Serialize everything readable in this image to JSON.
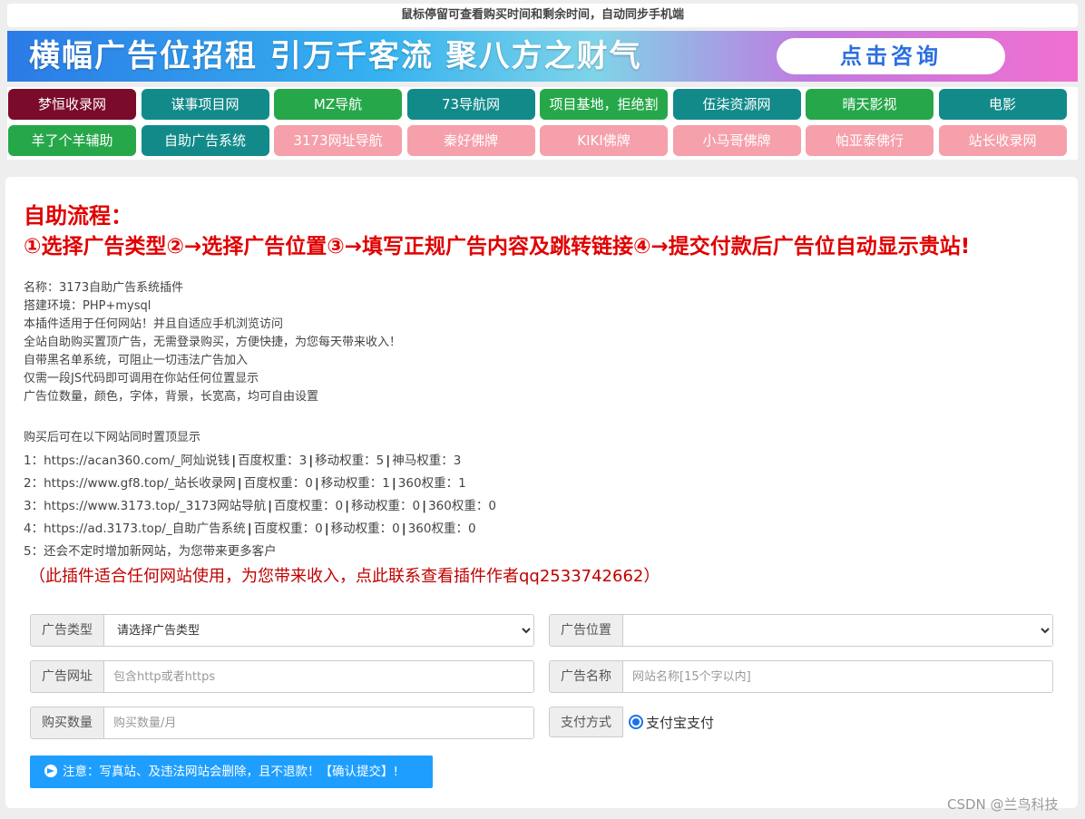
{
  "tip": "鼠标停留可查看购买时间和剩余时间，自动同步手机端",
  "banner": {
    "text": "横幅广告位招租  引万千客流  聚八方之财气",
    "button": "点击咨询"
  },
  "links": [
    {
      "label": "梦恒收录网",
      "color": "#7b0b2b"
    },
    {
      "label": "谋事项目网",
      "color": "#128a8a"
    },
    {
      "label": "MZ导航",
      "color": "#26a84a"
    },
    {
      "label": "73导航网",
      "color": "#128a8a"
    },
    {
      "label": "项目基地，拒绝割",
      "color": "#26a84a"
    },
    {
      "label": "伍柒资源网",
      "color": "#128a8a"
    },
    {
      "label": "晴天影视",
      "color": "#26a84a"
    },
    {
      "label": "电影",
      "color": "#128a8a"
    },
    {
      "label": "羊了个羊辅助",
      "color": "#26a84a"
    },
    {
      "label": "自助广告系统",
      "color": "#128a8a"
    },
    {
      "label": "3173网址导航",
      "color": "#f5a0ab"
    },
    {
      "label": "秦好佛牌",
      "color": "#f5a0ab"
    },
    {
      "label": "KIKI佛牌",
      "color": "#f5a0ab"
    },
    {
      "label": "小马哥佛牌",
      "color": "#f5a0ab"
    },
    {
      "label": "帕亚泰佛行",
      "color": "#f5a0ab"
    },
    {
      "label": "站长收录网",
      "color": "#f5a0ab"
    }
  ],
  "flow": {
    "title": "自助流程：",
    "steps": "①选择广告类型②→选择广告位置③→填写正规广告内容及跳转链接④→提交付款后广告位自动显示贵站!"
  },
  "info_lines": [
    "名称：3173自助广告系统插件",
    "搭建环境：PHP+mysql",
    "本插件适用于任何网站！并且自适应手机浏览访问",
    "全站自助购买置顶广告，无需登录购买，方便快捷，为您每天带来收入！",
    "自带黑名单系统，可阻止一切违法广告加入",
    "仅需一段JS代码即可调用在你站任何位置显示",
    "广告位数量，颜色，字体，背景，长宽高，均可自由设置"
  ],
  "sites_intro": "购买后可在以下网站同时置顶显示",
  "sites": [
    {
      "prefix": "1：",
      "url": "https://acan360.com/",
      "name": "_阿灿说钱",
      "w1": "百度权重：3",
      "w2": "移动权重：5",
      "w3": "神马权重：3"
    },
    {
      "prefix": "2：",
      "url": "https://www.gf8.top/",
      "name": "_站长收录网",
      "w1": "百度权重：0",
      "w2": "移动权重：1",
      "w3": "360权重：1"
    },
    {
      "prefix": "3：",
      "url": "https://www.3173.top/",
      "name": "_3173网站导航",
      "w1": "百度权重：0",
      "w2": "移动权重：0",
      "w3": "360权重：0"
    },
    {
      "prefix": "4：",
      "url": "https://ad.3173.top/",
      "name": "_自助广告系统",
      "w1": "百度权重：0",
      "w2": "移动权重：0",
      "w3": "360权重：0"
    }
  ],
  "sites_more": "5：还会不定时增加新网站，为您带来更多客户",
  "contact": "（此插件适合任何网站使用，为您带来收入，点此联系查看插件作者qq2533742662）",
  "form": {
    "ad_type_label": "广告类型",
    "ad_type_value": "请选择广告类型",
    "ad_position_label": "广告位置",
    "ad_position_value": "",
    "ad_url_label": "广告网址",
    "ad_url_placeholder": "包含http或者https",
    "ad_name_label": "广告名称",
    "ad_name_placeholder": "网站名称[15个字以内]",
    "quantity_label": "购买数量",
    "quantity_placeholder": "购买数量/月",
    "payment_label": "支付方式",
    "payment_option": "支付宝支付"
  },
  "submit": "注意：写真站、及违法网站会删除，且不退款！【确认提交】!",
  "watermark": "CSDN @兰鸟科技"
}
